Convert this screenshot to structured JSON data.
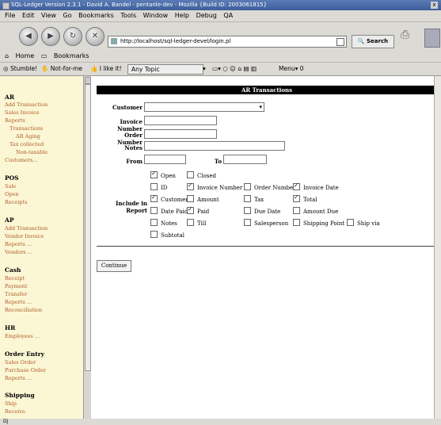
{
  "window": {
    "title": "SQL-Ledger Version 2.3.1 - David A. Bandel - pentanle-dev - Mozilla {Build ID: 2003061815}",
    "close": "x"
  },
  "menu": [
    "File",
    "Edit",
    "View",
    "Go",
    "Bookmarks",
    "Tools",
    "Window",
    "Help",
    "Debug",
    "QA"
  ],
  "nav": {
    "url": "http://localhost/sql-ledger-devel/login.pl",
    "search_label": "Search"
  },
  "bookmarks": {
    "home": "Home",
    "bookmarks": "Bookmarks"
  },
  "stumble": {
    "stumble": "Stumble!",
    "notforme": "Not-for-me",
    "ilikeit": "I like it!",
    "topic": "Any Topic",
    "menu": "Menu",
    "count": "0"
  },
  "sidebar": {
    "ar": "AR",
    "ar_add": "Add Transaction",
    "ar_sales": "Sales Invoice",
    "ar_reports": "Reports",
    "ar_transactions": "Transactions",
    "ar_aging": "AR Aging",
    "ar_tax": "Tax collected",
    "ar_nontax": "Non-taxable",
    "ar_customers": "Customers...",
    "pos": "POS",
    "pos_sale": "Sale",
    "pos_open": "Open",
    "pos_receipts": "Receipts",
    "ap": "AP",
    "ap_add": "Add Transaction",
    "ap_vendor_invoice": "Vendor Invoice",
    "ap_reports": "Reports ...",
    "ap_vendors": "Vendors ...",
    "cash": "Cash",
    "cash_receipt": "Receipt",
    "cash_payment": "Payment",
    "cash_transfer": "Transfer",
    "cash_reports": "Reports ...",
    "cash_recon": "Reconciliation",
    "hr": "HR",
    "hr_employees": "Employees ...",
    "oe": "Order Entry",
    "oe_sales": "Sales Order",
    "oe_purchase": "Purchase Order",
    "oe_reports": "Reports ...",
    "ship": "Shipping",
    "ship_ship": "Ship",
    "ship_receive": "Receive"
  },
  "form": {
    "header": "AR Transactions",
    "customer": "Customer",
    "invoice_number": "Invoice Number",
    "order_number": "Order Number",
    "notes": "Notes",
    "from": "From",
    "to": "To",
    "include": "Include in Report",
    "continue": "Continue"
  },
  "checks": {
    "open": "Open",
    "closed": "Closed",
    "id": "ID",
    "invnumber": "Invoice Number",
    "ordnumber": "Order Number",
    "invdate": "Invoice Date",
    "customer": "Customer",
    "amount": "Amount",
    "tax": "Tax",
    "total": "Total",
    "datepaid": "Date Paid",
    "paid": "Paid",
    "duedate": "Due Date",
    "amountdue": "Amount Due",
    "notes": "Notes",
    "till": "Till",
    "salesperson": "Salesperson",
    "shippingpoint": "Shipping Point",
    "shipvia": "Ship via",
    "subtotal": "Subtotal"
  },
  "status": {
    "text": "Dj"
  }
}
